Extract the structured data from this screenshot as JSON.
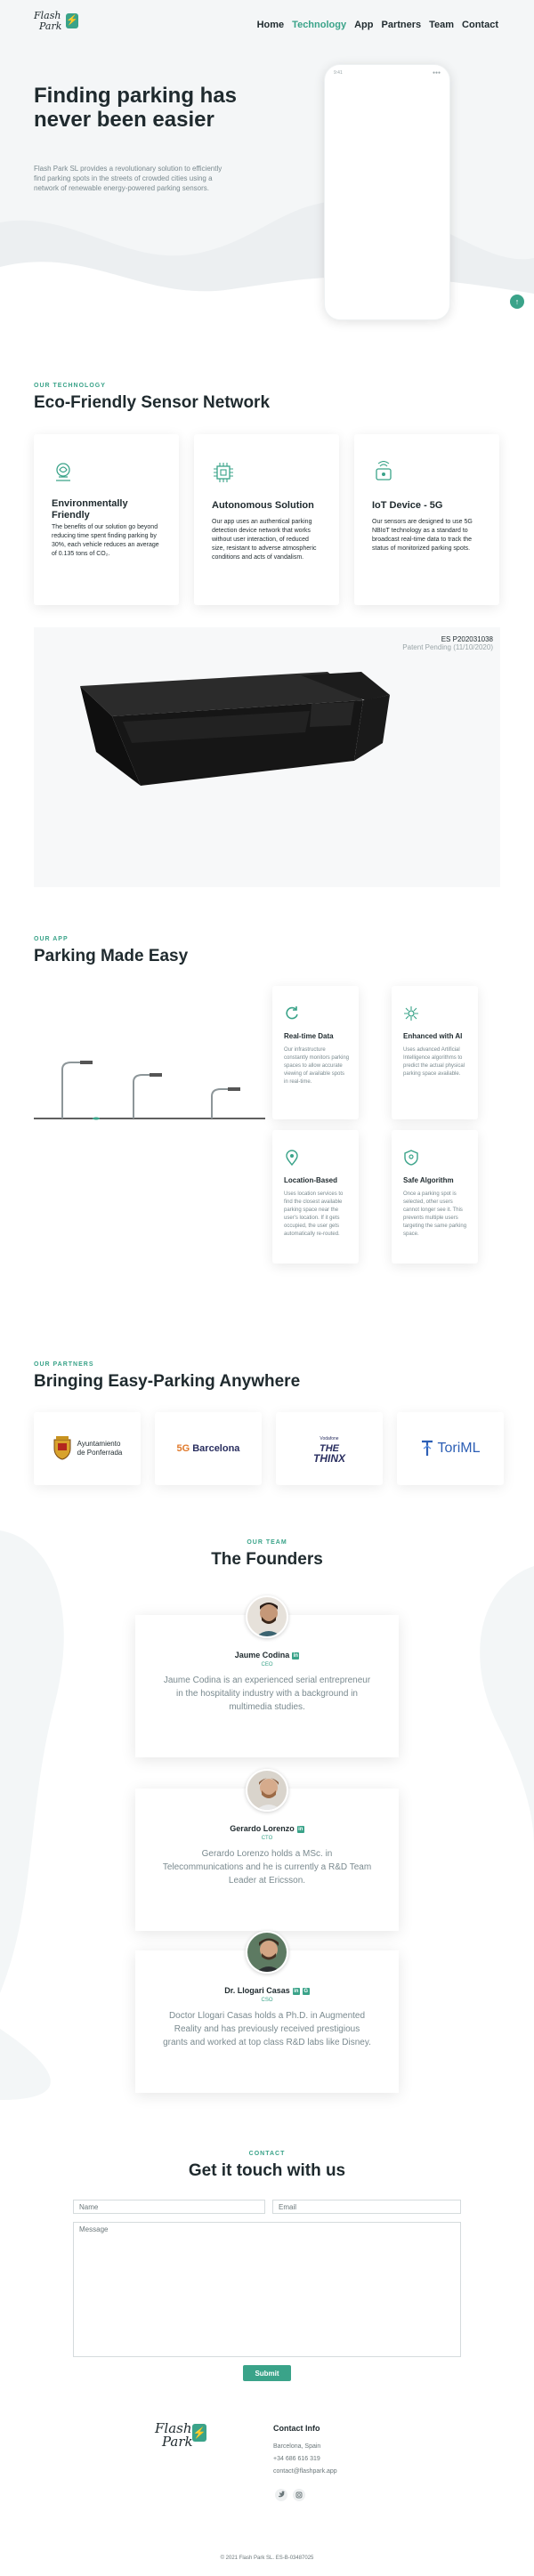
{
  "brand": {
    "logo_line1": "Flash",
    "logo_line2": "Park",
    "accent": "#3aa389"
  },
  "nav": {
    "items": [
      "Home",
      "Technology",
      "App",
      "Partners",
      "Team",
      "Contact"
    ],
    "active": "Technology"
  },
  "hero": {
    "title": "Finding parking has never been easier",
    "subtitle": "Flash Park SL provides a revolutionary solution to efficiently find parking spots in the streets of crowded cities using a network of renewable energy-powered parking sensors.",
    "phone_status_left": "9:41",
    "phone_status_right": "●●●"
  },
  "technology": {
    "kicker": "OUR TECHNOLOGY",
    "title": "Eco-Friendly Sensor Network",
    "cards": [
      {
        "icon": "eco-sensor-icon",
        "title": "Environmentally Friendly",
        "text": "The benefits of our solution go beyond reducing time spent finding parking by 30%, each vehicle reduces an average of 0.135 tons of CO₂."
      },
      {
        "icon": "chip-icon",
        "title": "Autonomous Solution",
        "text": "Our app uses an authentical parking detection device network that works without user interaction, of reduced size, resistant to adverse atmospheric conditions and acts of vandalism."
      },
      {
        "icon": "iot-device-icon",
        "title": "IoT Device - 5G",
        "text": "Our sensors are designed to use 5G NBIoT technology as a standard to broadcast real-time data to track the status of monitorized parking spots."
      }
    ],
    "patent_number": "ES P202031038",
    "patent_status": "Patent Pending (11/10/2020)"
  },
  "app": {
    "kicker": "OUR APP",
    "title": "Parking Made Easy",
    "features": [
      {
        "icon": "refresh-icon",
        "title": "Real-time Data",
        "text": "Our infrastructure constantly monitors parking spaces to allow accurate viewing of available spots in real-time."
      },
      {
        "icon": "ai-icon",
        "title": "Enhanced with AI",
        "text": "Uses advanced Artificial Intelligence algorithms to predict the actual physical parking space available."
      },
      {
        "icon": "location-pin-icon",
        "title": "Location-Based",
        "text": "Uses location services to find the closest available parking space near the user's location. If it gets occupied, the user gets automatically re-routed."
      },
      {
        "icon": "shield-icon",
        "title": "Safe Algorithm",
        "text": "Once a parking spot is selected, other users cannot longer see it. This prevents multiple users targeting the same parking space."
      }
    ]
  },
  "partners": {
    "kicker": "OUR PARTNERS",
    "title": "Bringing Easy-Parking Anywhere",
    "logos": [
      {
        "line1": "Ayuntamiento",
        "line2": "de Ponferrada"
      },
      {
        "line1": "Barcelona",
        "prefix": "5G"
      },
      {
        "line1": "THE",
        "line2": "THINX",
        "prefix": "Vodafone"
      },
      {
        "line1": "ToriML"
      }
    ]
  },
  "team": {
    "kicker": "OUR TEAM",
    "title": "The Founders",
    "founders": [
      {
        "name": "Jaume Codina",
        "role": "CEO",
        "bio": "Jaume Codina is an experienced serial entrepreneur in the hospitality industry with a background in multimedia studies."
      },
      {
        "name": "Gerardo Lorenzo",
        "role": "CTO",
        "bio": "Gerardo Lorenzo holds a MSc. in Telecommunications and he is currently a R&D Team Leader at Ericsson."
      },
      {
        "name": "Dr. Llogari Casas",
        "role": "CSO",
        "bio": "Doctor Llogari Casas holds a Ph.D. in Augmented Reality and has previously received prestigious grants and worked at top class R&D labs like Disney."
      }
    ]
  },
  "contact": {
    "kicker": "CONTACT",
    "title": "Get it touch with us",
    "name_placeholder": "Name",
    "email_placeholder": "Email",
    "message_placeholder": "Message",
    "submit_label": "Submit"
  },
  "footer": {
    "info_title": "Contact Info",
    "city": "Barcelona, Spain",
    "phone": "+34 686 616 319",
    "email": "contact@flashpark.app",
    "social": [
      "twitter-icon",
      "instagram-icon"
    ],
    "copyright": "© 2021 Flash Park SL. ES-B-03487025"
  }
}
